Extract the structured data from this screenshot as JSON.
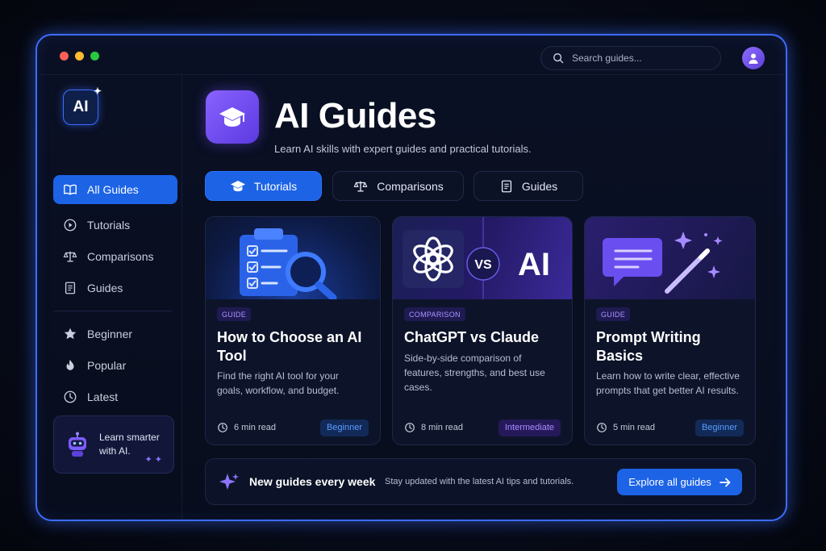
{
  "colors": {
    "accent": "#1c63e6",
    "window_border": "#3d6cff",
    "purple": "#6b47f0",
    "traffic_red": "#ff5f57",
    "traffic_yellow": "#febc2e",
    "traffic_green": "#28c840"
  },
  "search": {
    "placeholder": "Search guides..."
  },
  "sidebar": {
    "logo_text": "AI",
    "nav": [
      {
        "label": "All Guides",
        "icon": "book-open-icon",
        "active": true
      },
      {
        "label": "Tutorials",
        "icon": "play-circle-icon"
      },
      {
        "label": "Comparisons",
        "icon": "scale-icon"
      },
      {
        "label": "Guides",
        "icon": "document-icon"
      }
    ],
    "filters": [
      {
        "label": "Beginner",
        "icon": "star-icon"
      },
      {
        "label": "Popular",
        "icon": "flame-icon"
      },
      {
        "label": "Latest",
        "icon": "clock-icon"
      }
    ],
    "promo": {
      "line1": "Learn smarter",
      "line2": "with AI."
    }
  },
  "hero": {
    "title": "AI Guides",
    "subtitle": "Learn AI skills with expert guides and practical tutorials."
  },
  "tabs": [
    {
      "label": "Tutorials",
      "icon": "graduation-cap-icon",
      "active": true
    },
    {
      "label": "Comparisons",
      "icon": "scale-icon"
    },
    {
      "label": "Guides",
      "icon": "document-icon"
    }
  ],
  "cards": [
    {
      "badge": "GUIDE",
      "title": "How to Choose an AI Tool",
      "description": "Find the right AI tool for your goals, workflow, and budget.",
      "read_time": "6 min read",
      "level": "Beginner",
      "image": "clipboard-magnifier-icon"
    },
    {
      "badge": "COMPARISON",
      "title": "ChatGPT vs Claude",
      "description": "Side-by-side comparison of features, strengths, and best use cases.",
      "read_time": "8 min read",
      "level": "Intermediate",
      "image_left": "openai-logo-icon",
      "image_vs": "VS",
      "image_right": "AI"
    },
    {
      "badge": "GUIDE",
      "title": "Prompt Writing Basics",
      "description": "Learn how to write clear, effective prompts that get better AI results.",
      "read_time": "5 min read",
      "level": "Beginner",
      "image": "chat-bubble-wand-icon"
    }
  ],
  "banner": {
    "title": "New guides every week",
    "subtitle": "Stay updated with the latest AI tips and tutorials.",
    "button": "Explore all guides"
  }
}
